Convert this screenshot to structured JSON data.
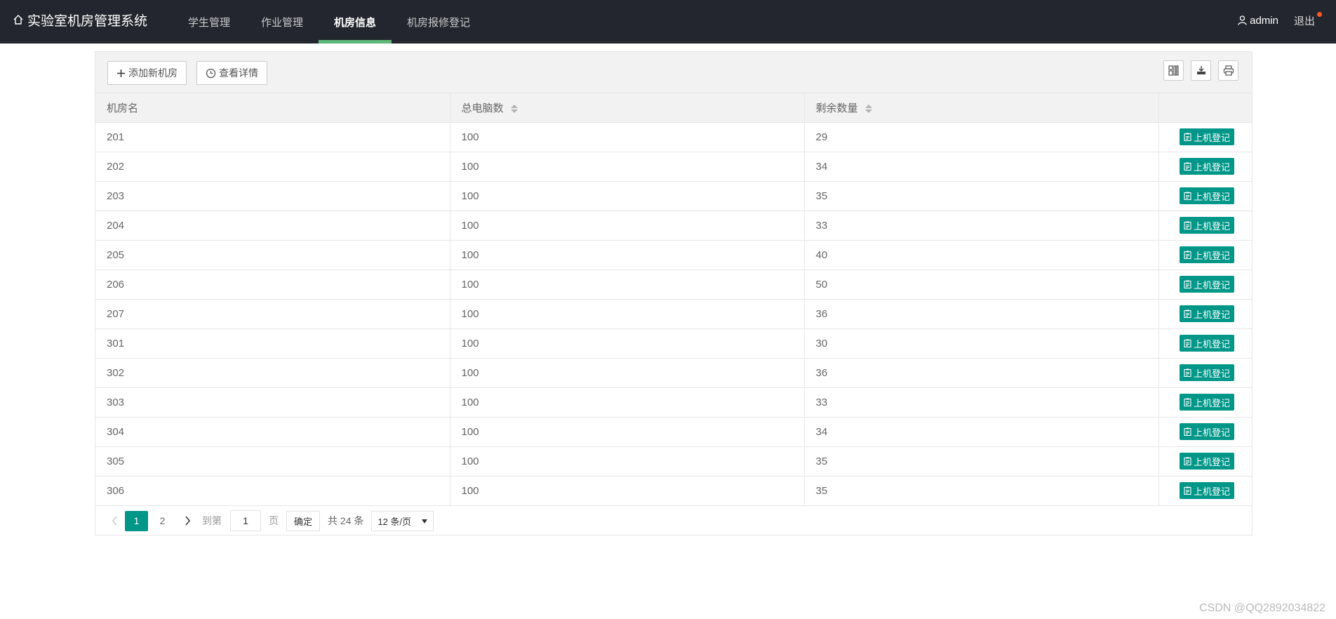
{
  "header": {
    "title": "实验室机房管理系统",
    "nav": [
      {
        "label": "学生管理",
        "active": false
      },
      {
        "label": "作业管理",
        "active": false
      },
      {
        "label": "机房信息",
        "active": true
      },
      {
        "label": "机房报修登记",
        "active": false
      }
    ],
    "user": "admin",
    "logout": "退出"
  },
  "toolbar": {
    "add_label": "添加新机房",
    "detail_label": "查看详情",
    "icons": [
      "columns-icon",
      "export-icon",
      "print-icon"
    ]
  },
  "table": {
    "columns": [
      "机房名",
      "总电脑数",
      "剩余数量",
      ""
    ],
    "action_label": "上机登记",
    "rows": [
      [
        "201",
        "100",
        "29"
      ],
      [
        "202",
        "100",
        "34"
      ],
      [
        "203",
        "100",
        "35"
      ],
      [
        "204",
        "100",
        "33"
      ],
      [
        "205",
        "100",
        "40"
      ],
      [
        "206",
        "100",
        "50"
      ],
      [
        "207",
        "100",
        "36"
      ],
      [
        "301",
        "100",
        "30"
      ],
      [
        "302",
        "100",
        "36"
      ],
      [
        "303",
        "100",
        "33"
      ],
      [
        "304",
        "100",
        "34"
      ],
      [
        "305",
        "100",
        "35"
      ],
      [
        "306",
        "100",
        "35"
      ]
    ]
  },
  "pager": {
    "pages": [
      "1",
      "2"
    ],
    "current": "1",
    "goto_label": "到第",
    "goto_value": "1",
    "page_label": "页",
    "confirm_label": "确定",
    "total_label": "共 24 条",
    "size_label": "12 条/页"
  },
  "watermark": "CSDN @QQ2892034822",
  "colors": {
    "header_bg": "#23262e",
    "accent": "#009688",
    "nav_active_bar": "#5fb878",
    "dot": "#ff5722"
  }
}
